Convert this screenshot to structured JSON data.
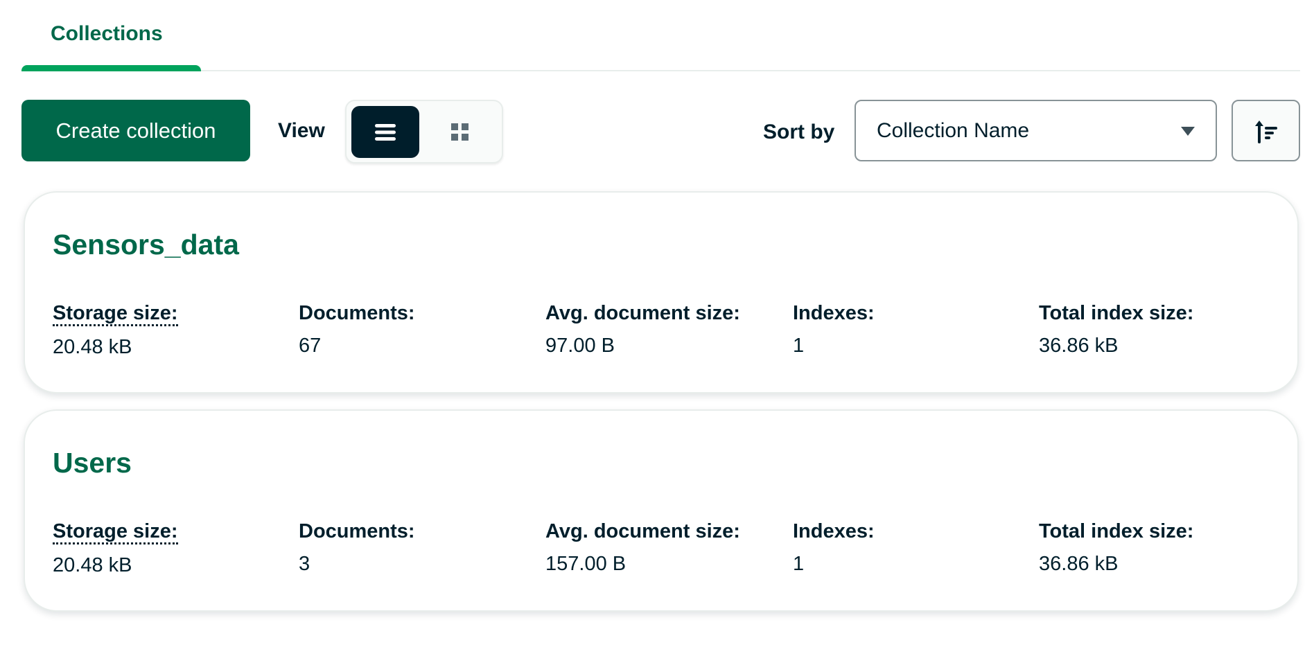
{
  "tabs": [
    {
      "label": "Collections",
      "active": true
    }
  ],
  "toolbar": {
    "create_label": "Create collection",
    "view_label": "View",
    "view_options": [
      {
        "icon": "list-icon",
        "active": true
      },
      {
        "icon": "grid-icon",
        "active": false
      }
    ],
    "sort_label": "Sort by",
    "sort_value": "Collection Name",
    "sort_direction_icon": "sort-ascending-icon"
  },
  "colors": {
    "accent": "#00684A",
    "tab_underline": "#00A35C",
    "dark": "#001E2B"
  },
  "collections": [
    {
      "name": "Sensors_data",
      "stats": [
        {
          "label": "Storage size:",
          "value": "20.48 kB"
        },
        {
          "label": "Documents:",
          "value": "67"
        },
        {
          "label": "Avg. document size:",
          "value": "97.00 B"
        },
        {
          "label": "Indexes:",
          "value": "1"
        },
        {
          "label": "Total index size:",
          "value": "36.86 kB"
        }
      ]
    },
    {
      "name": "Users",
      "stats": [
        {
          "label": "Storage size:",
          "value": "20.48 kB"
        },
        {
          "label": "Documents:",
          "value": "3"
        },
        {
          "label": "Avg. document size:",
          "value": "157.00 B"
        },
        {
          "label": "Indexes:",
          "value": "1"
        },
        {
          "label": "Total index size:",
          "value": "36.86 kB"
        }
      ]
    }
  ]
}
